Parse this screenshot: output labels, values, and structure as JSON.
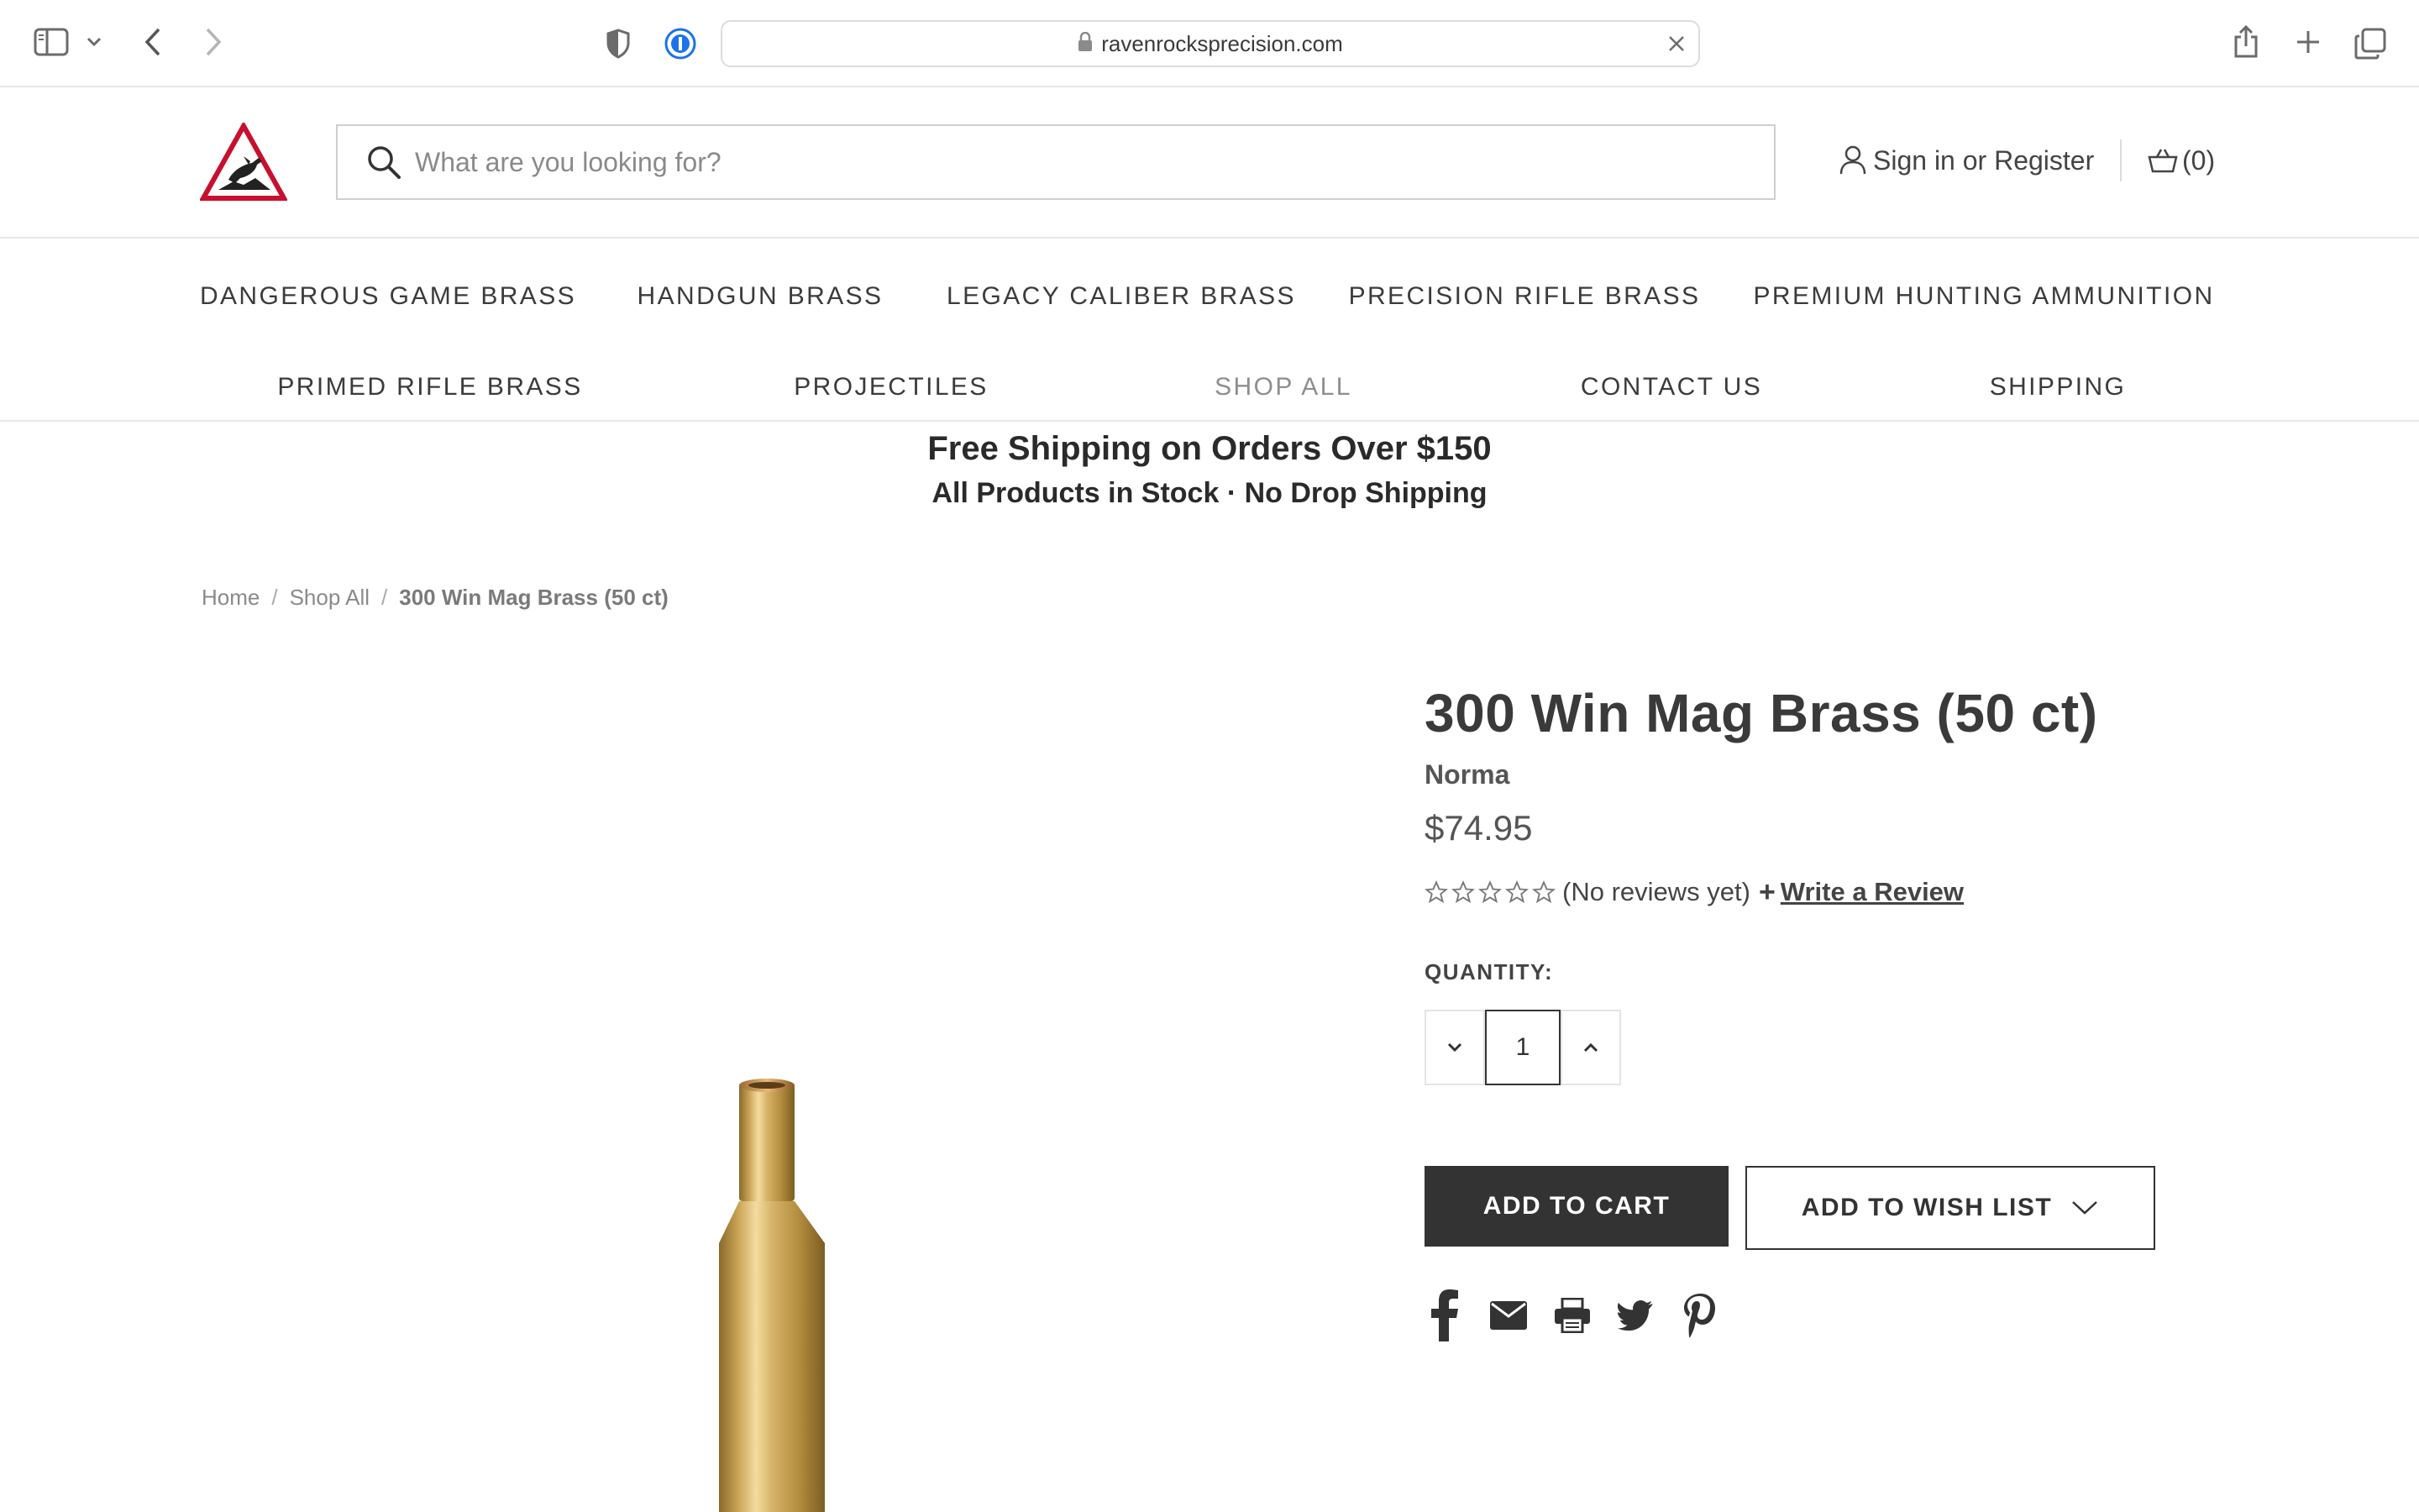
{
  "browser": {
    "url": "ravenrocksprecision.com",
    "icons": [
      "sidebar-icon",
      "chevron-down-icon",
      "back-icon",
      "forward-icon",
      "shield-icon",
      "password-manager-icon",
      "lock-icon",
      "clear-icon",
      "share-icon",
      "new-tab-icon",
      "tabs-icon"
    ]
  },
  "header": {
    "search_placeholder": "What are you looking for?",
    "signin_label": "Sign in or Register",
    "cart_label": "(0)"
  },
  "nav": {
    "row1": [
      "DANGEROUS GAME BRASS",
      "HANDGUN BRASS",
      "LEGACY CALIBER BRASS",
      "PRECISION RIFLE BRASS",
      "PREMIUM HUNTING AMMUNITION"
    ],
    "row2": [
      "PRIMED RIFLE BRASS",
      "PROJECTILES",
      "SHOP ALL",
      "CONTACT US",
      "SHIPPING"
    ]
  },
  "promo": {
    "line1": "Free Shipping on Orders Over $150",
    "line2": "All Products in Stock · No Drop Shipping"
  },
  "breadcrumb": {
    "home": "Home",
    "shop_all": "Shop All",
    "current": "300 Win Mag Brass (50 ct)",
    "separator": "/"
  },
  "product": {
    "title": "300 Win Mag Brass (50 ct)",
    "brand": "Norma",
    "price": "$74.95",
    "rating": {
      "stars_filled": 0,
      "stars_total": 5,
      "reviews_text": "(No reviews yet)",
      "plus": "+",
      "write_review": "Write a Review"
    },
    "quantity_label": "QUANTITY:",
    "quantity_value": "1",
    "add_to_cart": "ADD TO CART",
    "add_to_wishlist": "ADD TO WISH LIST"
  },
  "share_icons": [
    "facebook-icon",
    "email-icon",
    "print-icon",
    "twitter-icon",
    "pinterest-icon"
  ],
  "colors": {
    "button_dark": "#333333",
    "text": "#333333",
    "logo_red": "#c8102e",
    "brass": "#c9a456"
  }
}
